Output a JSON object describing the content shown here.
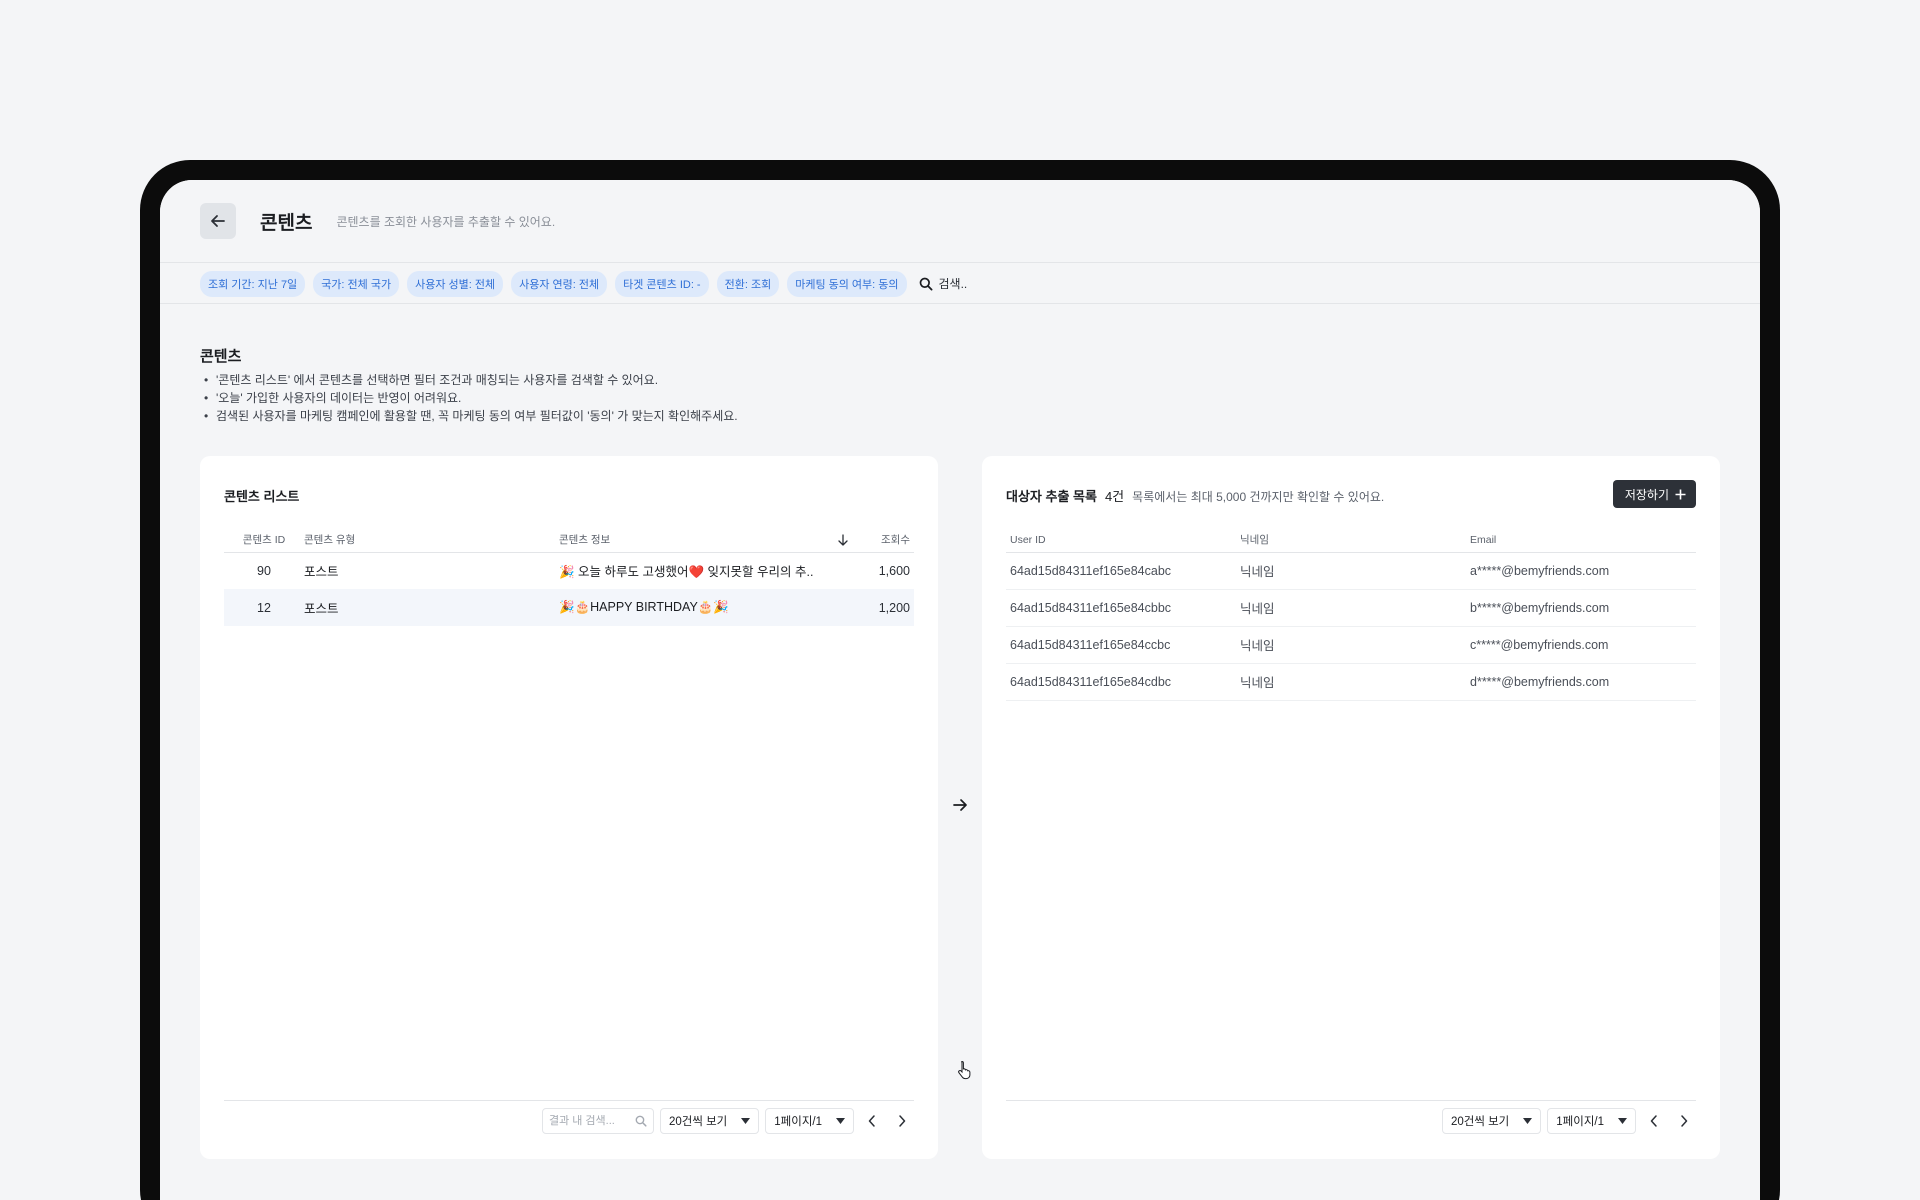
{
  "header": {
    "title": "콘텐츠",
    "description": "콘텐츠를 조회한 사용자를 추출할 수 있어요."
  },
  "filters": [
    "조회 기간: 지난 7일",
    "국가: 전체 국가",
    "사용자 성별: 전체",
    "사용자 연령: 전체",
    "타겟 콘텐츠 ID: -",
    "전환: 조회",
    "마케팅 동의 여부: 동의"
  ],
  "search": {
    "placeholder": "검색.."
  },
  "section": {
    "title": "콘텐츠",
    "notes": [
      "'콘텐츠 리스트' 에서 콘텐츠를 선택하면 필터 조건과 매칭되는 사용자를 검색할 수 있어요.",
      "'오늘' 가입한 사용자의 데이터는 반영이 어려워요.",
      "검색된 사용자를 마케팅 캠페인에 활용할 땐, 꼭 마케팅 동의 여부 필터값이 '동의' 가 맞는지 확인해주세요."
    ]
  },
  "content_list": {
    "title": "콘텐츠 리스트",
    "columns": {
      "id": "콘텐츠 ID",
      "type": "콘텐츠 유형",
      "info": "콘텐츠 정보",
      "views": "조회수"
    },
    "rows": [
      {
        "id": "90",
        "type": "포스트",
        "info": "🎉 오늘 하루도 고생했어❤️ 잊지못할 우리의 추..",
        "views": "1,600"
      },
      {
        "id": "12",
        "type": "포스트",
        "info": "🎉🎂HAPPY BIRTHDAY🎂🎉",
        "views": "1,200"
      }
    ],
    "footer": {
      "search_placeholder": "결과 내 검색...",
      "page_size": "20건씩 보기",
      "page": "1페이지/1"
    }
  },
  "extraction": {
    "title": "대상자 추출 목록",
    "count": "4건",
    "subtitle": "목록에서는 최대 5,000 건까지만 확인할 수 있어요.",
    "save_label": "저장하기",
    "columns": {
      "user_id": "User ID",
      "nickname": "닉네임",
      "email": "Email"
    },
    "rows": [
      {
        "user_id": "64ad15d84311ef165e84cabc",
        "nickname": "닉네임",
        "email": "a*****@bemyfriends.com"
      },
      {
        "user_id": "64ad15d84311ef165e84cbbc",
        "nickname": "닉네임",
        "email": "b*****@bemyfriends.com"
      },
      {
        "user_id": "64ad15d84311ef165e84ccbc",
        "nickname": "닉네임",
        "email": "c*****@bemyfriends.com"
      },
      {
        "user_id": "64ad15d84311ef165e84cdbc",
        "nickname": "닉네임",
        "email": "d*****@bemyfriends.com"
      }
    ],
    "footer": {
      "page_size": "20건씩 보기",
      "page": "1페이지/1"
    }
  },
  "icons": {
    "back": "arrow-left-icon",
    "search": "search-icon",
    "sort": "arrow-down-icon",
    "flow": "arrow-right-icon",
    "add": "plus-icon",
    "dropdown": "caret-down-icon",
    "prev": "chevron-left-icon",
    "next": "chevron-right-icon"
  },
  "colors": {
    "chip_bg": "#dde9fb",
    "chip_text": "#2f6fd6",
    "save_button": "#2d3138",
    "highlight_row": "#f3f6fb"
  }
}
